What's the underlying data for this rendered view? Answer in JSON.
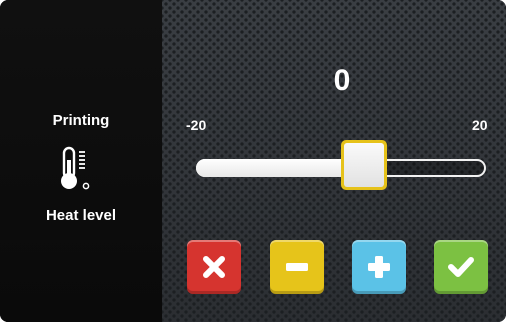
{
  "sidebar": {
    "status_label": "Printing",
    "mode_label": "Heat level",
    "icon": "thermometer-icon"
  },
  "adjuster": {
    "value": "0",
    "min_label": "-20",
    "max_label": "20",
    "min": -20,
    "max": 20,
    "current": 0
  },
  "buttons": {
    "cancel": "close-icon",
    "decrement": "minus-icon",
    "increment": "plus-icon",
    "confirm": "checkmark-icon"
  },
  "colors": {
    "cancel": "#d6342f",
    "decrement": "#e6c41a",
    "increment": "#5bc2e7",
    "confirm": "#7cc142",
    "thumb_border": "#e6c21a"
  }
}
